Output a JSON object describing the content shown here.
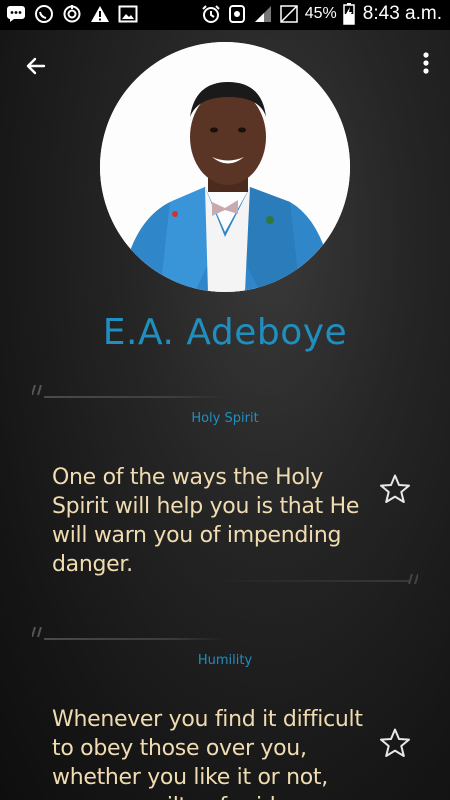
{
  "status_bar": {
    "battery_percent": "45%",
    "time": "8:43 a.m.",
    "icons": [
      "messages-icon",
      "whatsapp-icon",
      "sync-icon",
      "warning-icon",
      "image-icon",
      "alarm-icon",
      "data-saver-icon",
      "signal-icon",
      "no-signal-icon",
      "battery-charging-icon"
    ]
  },
  "header": {
    "back_icon": "arrow-back-icon",
    "menu_icon": "more-vert-icon"
  },
  "author": {
    "name": "E.A. Adeboye"
  },
  "colors": {
    "accent": "#1f8fc0",
    "quote_text": "#f0dcb0",
    "background": "#1e1e1e"
  },
  "quotes": [
    {
      "category": "Holy Spirit",
      "text": "One of the ways the Holy Spirit will help you is that He will warn you of impending danger.",
      "favorite_icon": "star-outline-icon"
    },
    {
      "category": "Humility",
      "text": "Whenever you find it difficult to obey those over you, whether you like it or not, you are guilty of pride.",
      "favorite_icon": "star-outline-icon"
    }
  ]
}
